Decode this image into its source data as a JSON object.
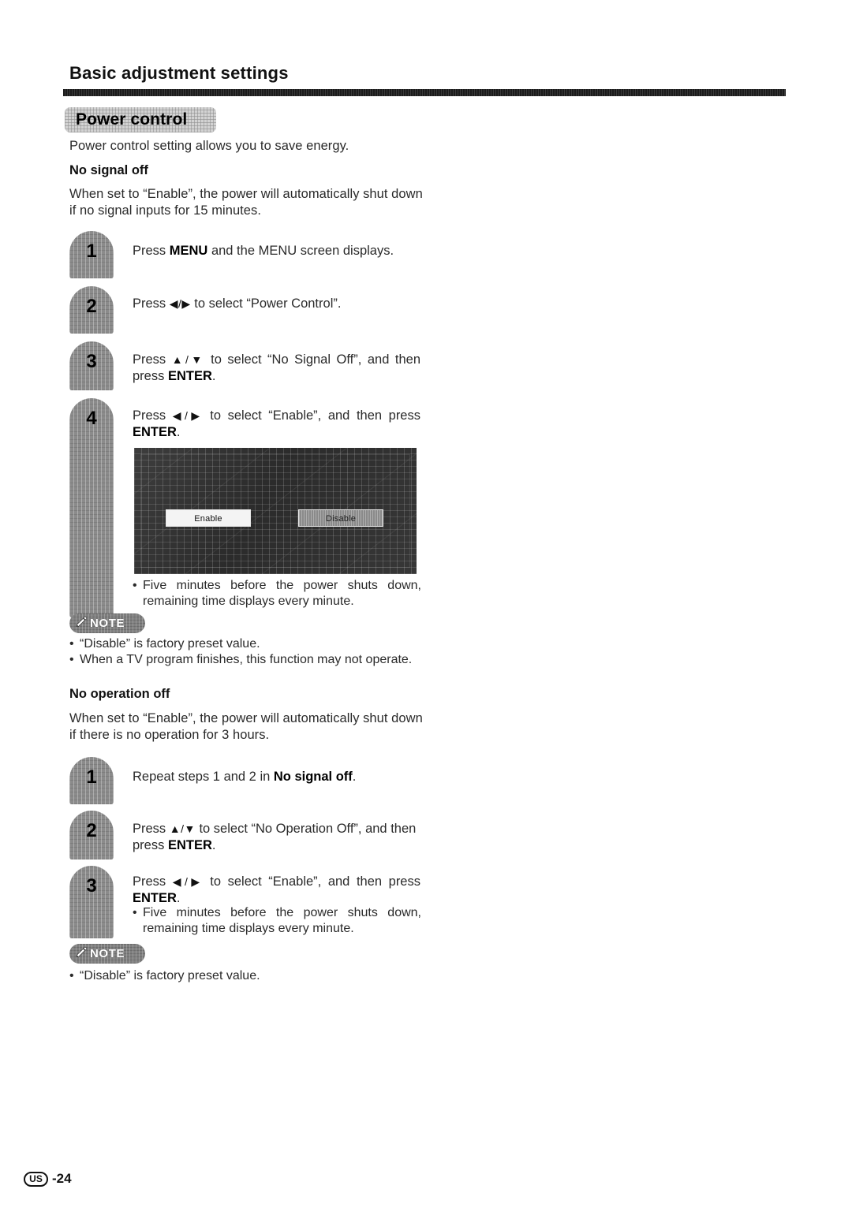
{
  "header": {
    "title": "Basic adjustment settings"
  },
  "section": {
    "badge_label": "Power control",
    "intro": "Power control setting allows you to save energy."
  },
  "no_signal_off": {
    "heading": "No signal off",
    "description": "When set to “Enable”, the power will automatically shut down if no signal inputs for 15 minutes.",
    "steps": [
      {
        "number": "1",
        "pre": "Press ",
        "bold1": "MENU",
        "mid": " and the MENU screen displays.",
        "bold2": "",
        "post": ""
      },
      {
        "number": "2",
        "pre": "Press ",
        "arrows": "◀/▶",
        "mid": " to select “Power Control”.",
        "bold2": "",
        "post": ""
      },
      {
        "number": "3",
        "pre": "Press ",
        "arrows": "▲/▼",
        "mid": " to select “No Signal Off”, and then press ",
        "bold2": "ENTER",
        "post": "."
      },
      {
        "number": "4",
        "pre": "Press ",
        "arrows": "◀/▶",
        "mid": " to select “Enable”, and then press ",
        "bold2": "ENTER",
        "post": "."
      }
    ],
    "screenshot": {
      "name": "power-control-no-signal-off-menu",
      "enable_label": "Enable",
      "disable_label": "Disable",
      "selected": "Disable"
    },
    "inline_bullets": [
      "Five minutes before the power shuts down, remaining time displays every minute."
    ],
    "note": {
      "label": "NOTE",
      "bullets": [
        "“Disable” is factory preset value.",
        "When a TV program finishes, this function may not operate."
      ]
    }
  },
  "no_operation_off": {
    "heading": "No operation off",
    "description": "When set to “Enable”, the power will automatically shut down if there is no operation for 3 hours.",
    "steps": [
      {
        "number": "1",
        "pre": "Repeat steps 1 and 2 in ",
        "bold2": "No signal off",
        "post": "."
      },
      {
        "number": "2",
        "pre": "Press ",
        "arrows": "▲/▼",
        "mid": " to select “No Operation Off”, and then press ",
        "bold2": "ENTER",
        "post": "."
      },
      {
        "number": "3",
        "pre": "Press ",
        "arrows": "◀/▶",
        "mid": " to select “Enable”, and then press ",
        "bold2": "ENTER",
        "post": "."
      }
    ],
    "inline_bullets": [
      "Five minutes before the power shuts down, remaining time displays every minute."
    ],
    "note": {
      "label": "NOTE",
      "bullets": [
        "“Disable” is factory preset value."
      ]
    }
  },
  "footer": {
    "region": "US",
    "page": "-24"
  },
  "bullet_glyph": "•",
  "colors": {
    "text": "#2a2a2a",
    "heading": "#111111",
    "badge_gray": "#8b8b8b",
    "note_gray": "#7e7e7e",
    "section_badge_gray": "#d3d3d3",
    "screen_dark": "#303030"
  }
}
